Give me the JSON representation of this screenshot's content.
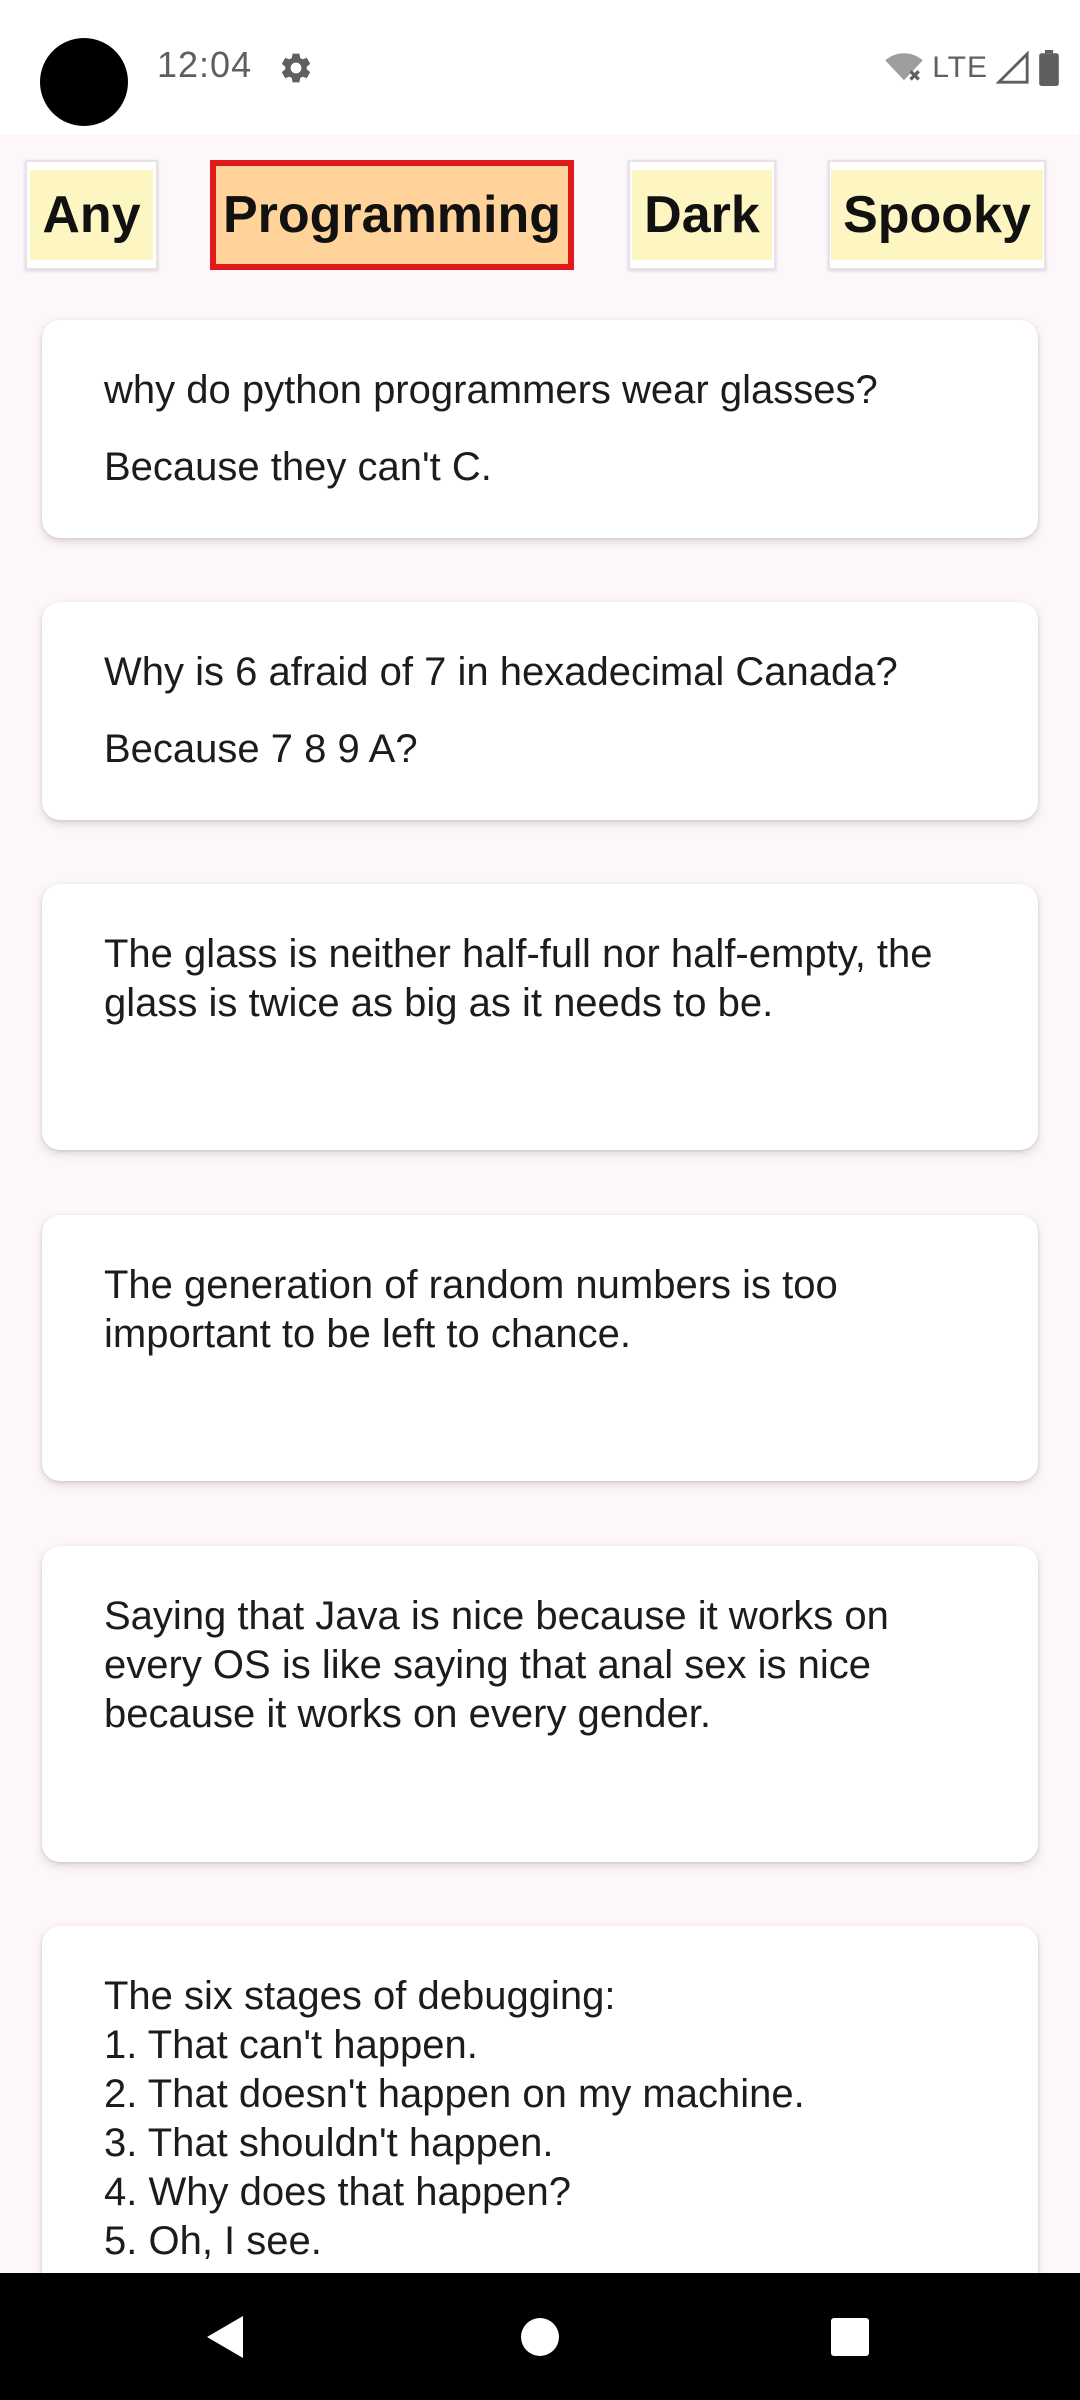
{
  "status_bar": {
    "time": "12:04",
    "network": "LTE"
  },
  "categories": [
    {
      "label": "Any",
      "selected": false
    },
    {
      "label": "Programming",
      "selected": true
    },
    {
      "label": "Dark",
      "selected": false
    },
    {
      "label": "Spooky",
      "selected": false
    }
  ],
  "jokes": [
    {
      "setup": "why do python programmers wear glasses?",
      "delivery": "Because they can't C."
    },
    {
      "setup": "Why is 6 afraid of 7 in hexadecimal Canada?",
      "delivery": "Because 7 8 9 A?"
    },
    {
      "joke": "The glass is neither half-full nor half-empty, the\nglass is twice as big as it needs to be."
    },
    {
      "joke": "The generation of random numbers is too\nimportant to be left to chance."
    },
    {
      "joke": "Saying that Java is nice because it works on\nevery OS is like saying that anal sex is nice\nbecause it works on every gender."
    },
    {
      "joke": "The six stages of debugging:\n1. That can't happen.\n2. That doesn't happen on my machine.\n3. That shouldn't happen.\n4. Why does that happen?\n5. Oh, I see."
    }
  ],
  "colors": {
    "chip_fill": "#fdf5c2",
    "chip_selected_fill": "#ffd39a",
    "chip_selected_border": "#e0191b",
    "background": "#fdf7fb"
  },
  "icons": {
    "settings": "gear-icon",
    "wifi": "wifi-off-icon",
    "signal": "cell-signal-icon",
    "battery": "battery-icon",
    "back": "back-triangle-icon",
    "home": "home-circle-icon",
    "recents": "recents-square-icon"
  }
}
